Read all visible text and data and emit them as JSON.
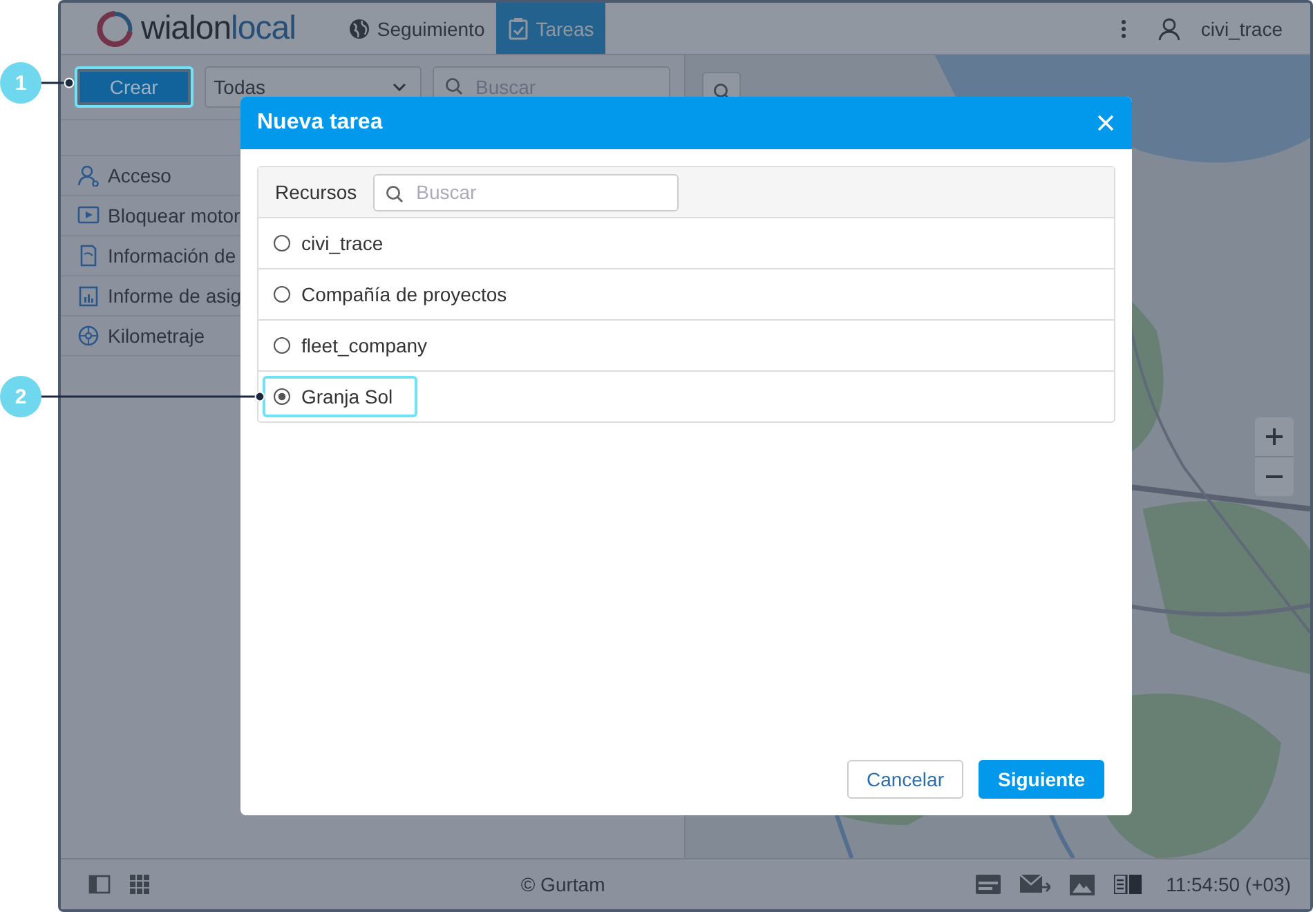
{
  "logo": {
    "part_1": "wialon",
    "part_2": "local"
  },
  "nav_tabs": [
    {
      "label": "Seguimiento",
      "kind": "globe",
      "selected": false
    },
    {
      "label": "Tareas",
      "kind": "clipboard",
      "selected": true
    }
  ],
  "user": "civi_trace",
  "toolbar": {
    "create_button": {
      "label": "Crear",
      "highlighted": true
    },
    "filter": {
      "value": "Todas"
    },
    "search": {
      "placeholder": "Buscar"
    }
  },
  "task_types": [
    {
      "label": "Acceso",
      "kind": "user"
    },
    {
      "label": "Bloquear motor",
      "kind": "play"
    },
    {
      "label": "Información de",
      "kind": "document"
    },
    {
      "label": "Informe de asig",
      "kind": "report"
    },
    {
      "label": "Kilometraje",
      "kind": "wheel"
    }
  ],
  "status_bar": {
    "copyright": "© Gurtam",
    "time": "11:54:50 (+03)"
  },
  "dialog": {
    "title": "Nueva tarea",
    "column": "Recursos",
    "search": {
      "placeholder": "Buscar"
    },
    "resources": [
      {
        "name": "civi_trace",
        "selected": false,
        "highlighted": false
      },
      {
        "name": "Compañía de proyectos",
        "selected": false,
        "highlighted": false
      },
      {
        "name": "fleet_company",
        "selected": false,
        "highlighted": false
      },
      {
        "name": "Granja Sol",
        "selected": true,
        "highlighted": true
      }
    ],
    "buttons": [
      {
        "label": "Cancelar",
        "kind": "secondary"
      },
      {
        "label": "Siguiente",
        "kind": "primary"
      }
    ]
  },
  "callouts": [
    {
      "label": "1"
    },
    {
      "label": "2"
    }
  ]
}
